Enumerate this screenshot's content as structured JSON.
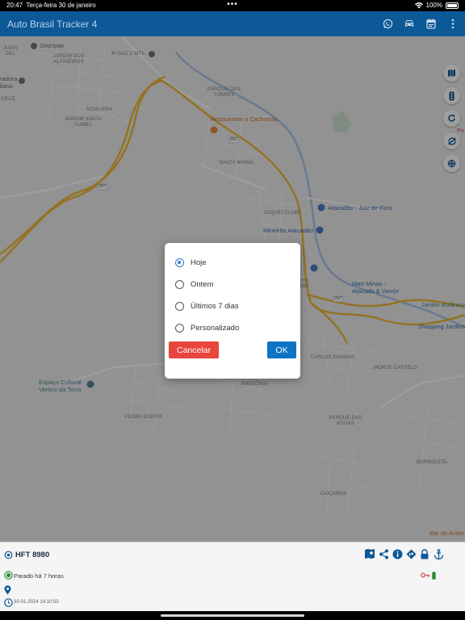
{
  "status_bar": {
    "time": "20:47",
    "date": "Terça-feira 30 de janeiro",
    "battery": "100%"
  },
  "app": {
    "title": "Auto Brasil Tracker 4"
  },
  "map": {
    "labels": [
      "JARDIM DOS ALFINEIROS",
      "NOVA ERA",
      "JARDIM SANTA ISABEL",
      "4º GAC L MTh",
      "PARQUE DAS TORRES",
      "SANTA MARIA",
      "JOQUEI CLUBE",
      "CARLOS CHAGAS",
      "MONTE CASTELO",
      "AMAZÔNIA",
      "PEDRA BONITA",
      "PARQUE DAS ÁGUAS",
      "BORBOLETA",
      "CAIÇARAS",
      "JUIAS DEL",
      "CRUZ",
      "FRANCISCO BERNARDINO"
    ],
    "pois": {
      "distripan": "Distripan",
      "restaurante": "Restaurante o Cachorrão",
      "atacadao": "Atacadão - Juiz de Fora",
      "mineirao": "Mineirão Atacadão",
      "mart_minas": "Mart Minas - Atacado & Varejo",
      "jardim_botanico": "Jardim Botânico",
      "shopping": "Shopping Jardins",
      "espaco_cultural": "Espaço Cultural Vertice da Terra",
      "bar": "Bar do Anton",
      "radora": "radora liano",
      "po": "Po"
    },
    "road_shields": [
      "267",
      "267",
      "267"
    ]
  },
  "dialog": {
    "options": [
      "Hoje",
      "Ontem",
      "Últimos 7 dias",
      "Personalizado"
    ],
    "selected": "Hoje",
    "cancel_label": "Cancelar",
    "ok_label": "OK"
  },
  "vehicle": {
    "plate": "HFT 8980",
    "status": "Parado há 7 horas",
    "timestamp": "30-01-2024 14:10:50"
  },
  "colors": {
    "app_bar": "#0d5897",
    "cancel": "#e8453c",
    "ok": "#0d74c4",
    "road": "#f0b83a"
  }
}
